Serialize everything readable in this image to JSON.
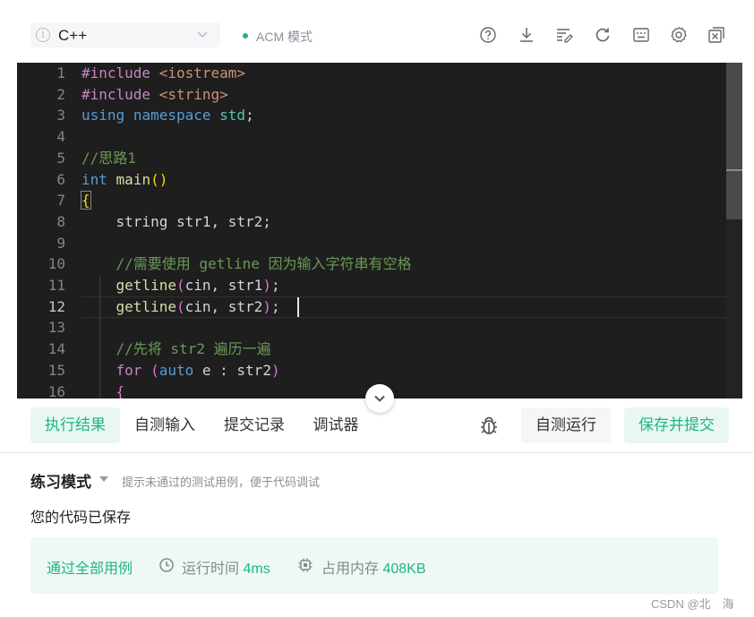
{
  "toolbar": {
    "language": "C++",
    "mode": "ACM 模式",
    "icons": [
      "help-circle-icon",
      "download-icon",
      "format-code-icon",
      "refresh-icon",
      "keyboard-icon",
      "settings-gear-icon",
      "fullscreen-exit-icon"
    ]
  },
  "editor": {
    "active_line": 12,
    "lines": [
      {
        "n": "1",
        "html": "<span class=\"pp\">#include</span> <span class=\"inc\">&lt;iostream&gt;</span>"
      },
      {
        "n": "2",
        "html": "<span class=\"pp\">#include</span> <span class=\"inc\">&lt;string&gt;</span>"
      },
      {
        "n": "3",
        "html": "<span class=\"kw\">using</span> <span class=\"kw\">namespace</span> <span class=\"ns\">std</span>;"
      },
      {
        "n": "4",
        "html": ""
      },
      {
        "n": "5",
        "html": "<span class=\"cm\">//思路1</span>"
      },
      {
        "n": "6",
        "html": "<span class=\"kw\">int</span> <span class=\"fn\">main</span><span class=\"br\">()</span>"
      },
      {
        "n": "7",
        "html": "<span class=\"br\" style=\"outline:1px solid #888\">{</span>"
      },
      {
        "n": "8",
        "html": "    string str1, str2;"
      },
      {
        "n": "9",
        "html": ""
      },
      {
        "n": "10",
        "html": "    <span class=\"cm\">//需要使用 getline 因为输入字符串有空格</span>"
      },
      {
        "n": "11",
        "html": "    <span class=\"fn\">getline</span><span class=\"br2\">(</span>cin, str1<span class=\"br2\">)</span>;"
      },
      {
        "n": "12",
        "html": "    <span class=\"fn\">getline</span><span class=\"br2\">(</span>cin, str2<span class=\"br2\">)</span>;"
      },
      {
        "n": "13",
        "html": ""
      },
      {
        "n": "14",
        "html": "    <span class=\"cm\">//先将 str2 遍历一遍</span>"
      },
      {
        "n": "15",
        "html": "    <span class=\"kw2\">for</span> <span class=\"br2\">(</span><span class=\"kw\">auto</span> e : str2<span class=\"br2\">)</span>"
      },
      {
        "n": "16",
        "html": "    <span class=\"br2\">{</span>"
      }
    ]
  },
  "tabs": {
    "items": [
      "执行结果",
      "自测输入",
      "提交记录",
      "调试器"
    ],
    "active": 0,
    "run_label": "自测运行",
    "submit_label": "保存并提交"
  },
  "result": {
    "practice_title": "练习模式",
    "practice_hint": "提示未通过的测试用例，便于代码调试",
    "saved_message": "您的代码已保存",
    "pass_text": "通过全部用例",
    "time_label": "运行时间",
    "time_value": "4ms",
    "memory_label": "占用内存",
    "memory_value": "408KB"
  },
  "watermark": "CSDN @北　海",
  "colors": {
    "accent": "#1fb584",
    "editor_bg": "#1e1e1e"
  }
}
